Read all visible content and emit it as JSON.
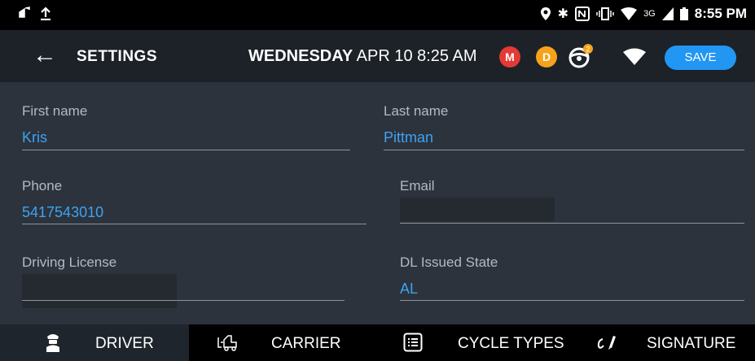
{
  "status_bar": {
    "time": "8:55 PM",
    "network": "3G"
  },
  "app_bar": {
    "title": "SETTINGS",
    "day": "WEDNESDAY",
    "date_time": "APR 10 8:25 AM",
    "badge_m": "M",
    "badge_d": "D",
    "wheel_count": "2",
    "save_label": "SAVE"
  },
  "form": {
    "first_name": {
      "label": "First name",
      "value": "Kris"
    },
    "last_name": {
      "label": "Last name",
      "value": "Pittman"
    },
    "phone": {
      "label": "Phone",
      "value": "5417543010"
    },
    "email": {
      "label": "Email",
      "value": ""
    },
    "driving_license": {
      "label": "Driving License",
      "value": ""
    },
    "dl_issued_state": {
      "label": "DL Issued State",
      "value": "AL"
    }
  },
  "tabs": [
    {
      "label": "DRIVER",
      "icon": "driver-icon",
      "active": true
    },
    {
      "label": "CARRIER",
      "icon": "forklift-icon",
      "active": false
    },
    {
      "label": "CYCLE TYPES",
      "icon": "list-icon",
      "active": false
    },
    {
      "label": "SIGNATURE",
      "icon": "signature-icon",
      "active": false
    }
  ],
  "colors": {
    "accent": "#2196f3",
    "value_text": "#3ea2f3",
    "background": "#2c333c",
    "app_bar": "#1d2229"
  }
}
